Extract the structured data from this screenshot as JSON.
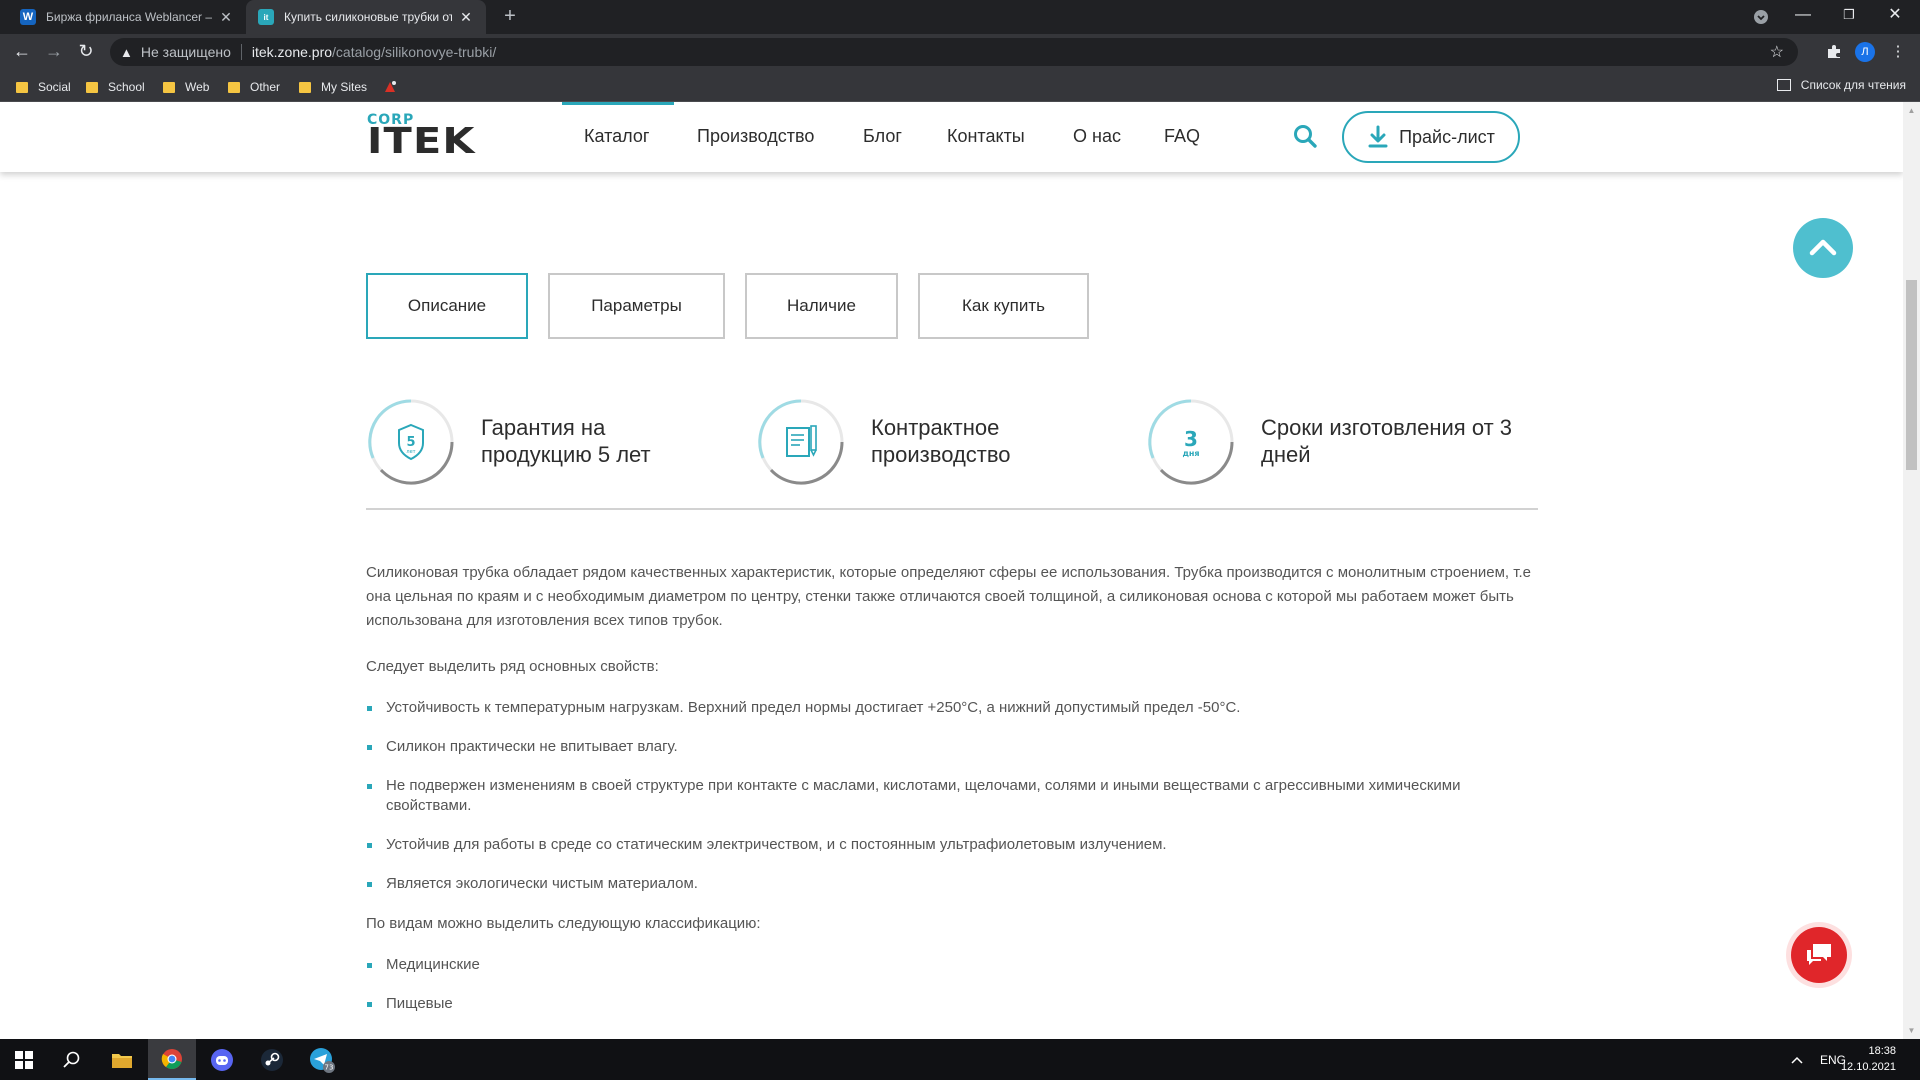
{
  "browser": {
    "tabs": [
      {
        "title": "Биржа фриланса Weblancer — с",
        "favicon_letter": "W",
        "favicon_color": "#1565c0",
        "active": false
      },
      {
        "title": "Купить силиконовые трубки от",
        "favicon_letter": "it",
        "favicon_color": "#2aa7b9",
        "active": true
      }
    ],
    "security_label": "Не защищено",
    "url_host": "itek.zone.pro",
    "url_path": "/catalog/silikonovye-trubki/",
    "profile_initial": "Л",
    "bookmarks": [
      "Social",
      "School",
      "Web",
      "Other",
      "My Sites"
    ],
    "reading_list": "Список для чтения"
  },
  "site": {
    "logo_corp": "CORP",
    "logo_name": "ITEK",
    "nav": [
      "Каталог",
      "Производство",
      "Блог",
      "Контакты",
      "О нас",
      "FAQ"
    ],
    "price_button": "Прайс-лист",
    "accent_color": "#2aa7b9"
  },
  "product_tabs": [
    {
      "label": "Описание",
      "active": true
    },
    {
      "label": "Параметры",
      "active": false
    },
    {
      "label": "Наличие",
      "active": false
    },
    {
      "label": "Как купить",
      "active": false
    }
  ],
  "features": [
    {
      "icon": "shield-5-years-icon",
      "icon_text": "5",
      "icon_sub": "лет",
      "text": "Гарантия на продукцию 5 лет"
    },
    {
      "icon": "contract-document-icon",
      "text": "Контрактное производство"
    },
    {
      "icon": "three-days-icon",
      "icon_text": "3",
      "icon_sub": "дня",
      "text": "Сроки изготовления от 3 дней"
    }
  ],
  "description": {
    "intro": "Силиконовая трубка обладает рядом качественных характеристик, которые определяют сферы ее использования. Трубка производится с монолитным строением, т.е она цельная по краям и с необходимым диаметром по центру, стенки также отличаются своей толщиной, а силиконовая основа с которой мы работаем может быть использована для изготовления всех типов трубок.",
    "properties_heading": "Следует выделить ряд основных свойств:",
    "properties": [
      "Устойчивость к температурным нагрузкам. Верхний предел нормы достигает +250°С, а нижний допустимый предел -50°С.",
      "Силикон практически не впитывает влагу.",
      "Не подвержен изменениям в своей структуре при контакте с маслами, кислотами, щелочами, солями и иными веществами с агрессивными химическими свойствами.",
      "Устойчив для работы в среде со статическим электричеством, и с постоянным ультрафиолетовым излучением.",
      "Является экологически чистым материалом."
    ],
    "classification_heading": "По видам можно выделить следующую классификацию:",
    "classification": [
      "Медицинские",
      "Пищевые"
    ]
  },
  "taskbar": {
    "apps": [
      "windows-start-icon",
      "search-icon",
      "file-explorer-icon",
      "chrome-icon",
      "discord-icon",
      "steam-icon",
      "telegram-icon"
    ],
    "telegram_badge": "73",
    "language": "ENG",
    "time": "18:38",
    "date": "12.10.2021"
  }
}
